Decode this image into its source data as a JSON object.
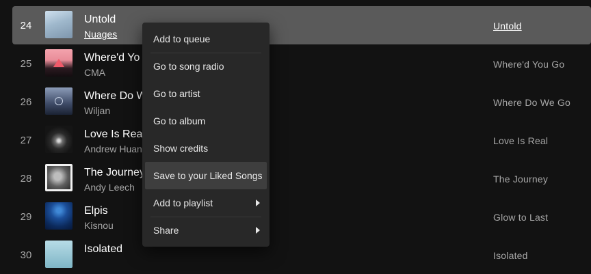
{
  "tracks": [
    {
      "number": "24",
      "title": "Untold",
      "artist": "Nuages",
      "album": "Untold"
    },
    {
      "number": "25",
      "title": "Where'd Yo",
      "artist": "CMA",
      "album": "Where'd You Go"
    },
    {
      "number": "26",
      "title": "Where Do W",
      "artist": "Wiljan",
      "album": "Where Do We Go"
    },
    {
      "number": "27",
      "title": "Love Is Real",
      "artist": "Andrew Huan",
      "album": "Love Is Real"
    },
    {
      "number": "28",
      "title": "The Journey",
      "artist": "Andy Leech",
      "album": "The Journey"
    },
    {
      "number": "29",
      "title": "Elpis",
      "artist": "Kisnou",
      "album": "Glow to Last"
    },
    {
      "number": "30",
      "title": "Isolated",
      "artist": "",
      "album": "Isolated"
    }
  ],
  "context_menu": {
    "items": [
      {
        "label": "Add to queue"
      },
      {
        "label": "Go to song radio"
      },
      {
        "label": "Go to artist"
      },
      {
        "label": "Go to album"
      },
      {
        "label": "Show credits"
      },
      {
        "label": "Save to your Liked Songs"
      },
      {
        "label": "Add to playlist"
      },
      {
        "label": "Share"
      }
    ]
  },
  "colors": {
    "background": "#121212",
    "selected_row": "#5a5a5a",
    "menu_background": "#282828",
    "menu_hover": "#3e3e3e",
    "secondary_text": "#a7a7a7"
  }
}
